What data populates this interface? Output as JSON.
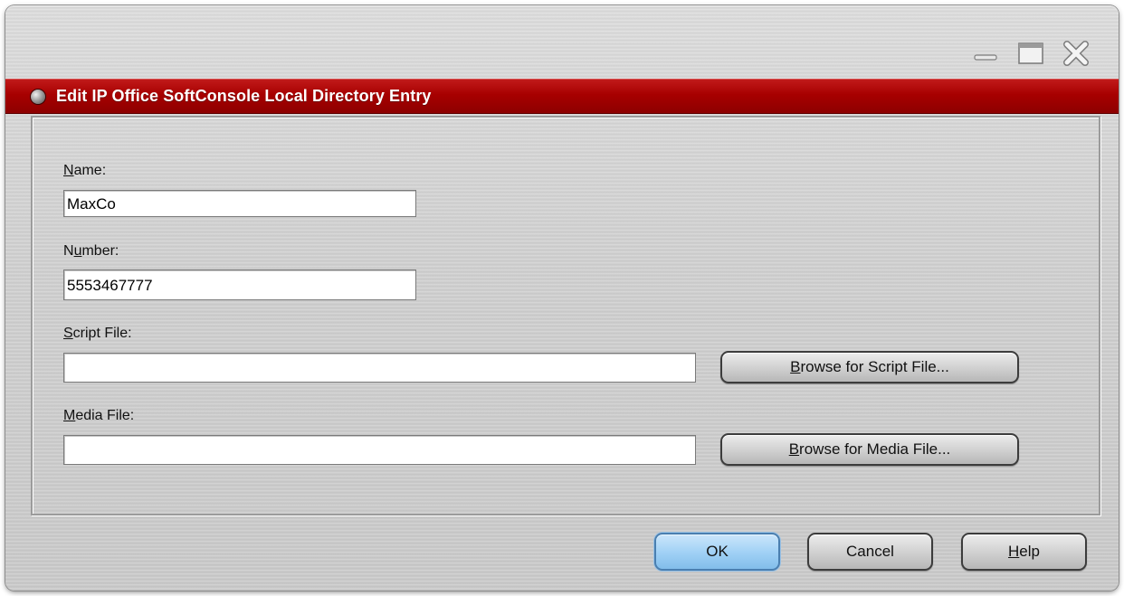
{
  "window": {
    "title": "Edit IP Office SoftConsole Local Directory Entry",
    "controls": [
      "minimize-icon",
      "maximize-icon",
      "close-icon"
    ]
  },
  "form": {
    "name": {
      "label_u": "N",
      "label_rest": "ame:",
      "value": "MaxCo"
    },
    "number": {
      "label_pre": "N",
      "label_u": "u",
      "label_rest": "mber:",
      "value": "5553467777"
    },
    "script": {
      "label_u": "S",
      "label_rest": "cript File:",
      "value": "",
      "browse_u": "B",
      "browse_rest": "rowse for Script File..."
    },
    "media": {
      "label_u": "M",
      "label_rest": "edia File:",
      "value": "",
      "browse_u": "B",
      "browse_rest": "rowse for Media File..."
    }
  },
  "buttons": {
    "ok": "OK",
    "cancel": "Cancel",
    "help_u": "H",
    "help_rest": "elp"
  },
  "colors": {
    "titlebar": "#a70000",
    "ok_button": "#9fd0f5"
  }
}
